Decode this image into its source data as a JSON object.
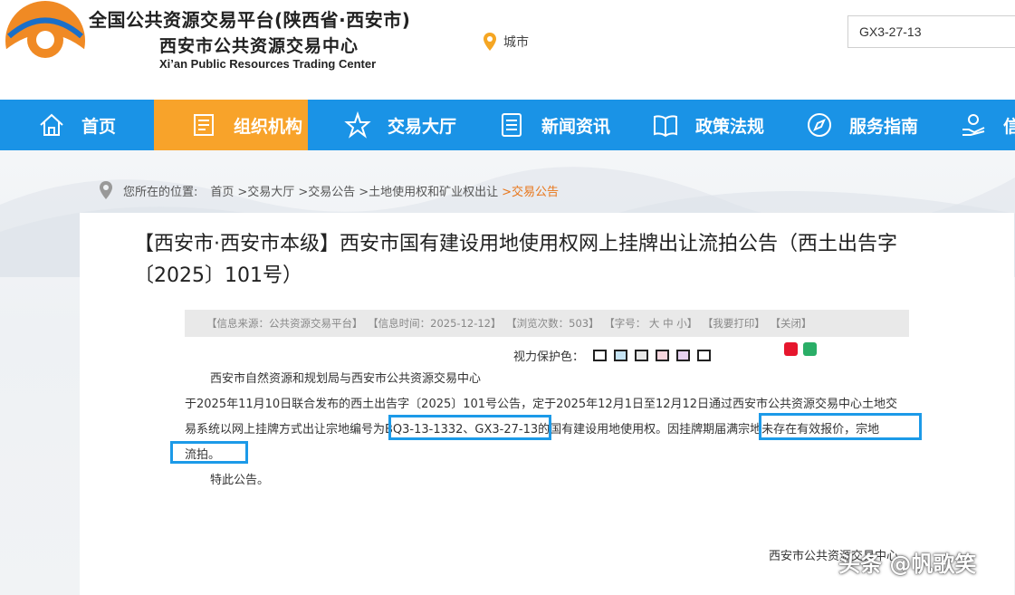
{
  "header": {
    "title_main": "全国公共资源交易平台(陕西省·西安市)",
    "title_sub": "西安市公共资源交易中心",
    "title_en": "Xi’an Public Resources Trading Center",
    "city_label": "城市",
    "search_value": "GX3-27-13"
  },
  "nav": {
    "items": [
      {
        "label": "首页",
        "icon": "home-icon"
      },
      {
        "label": "组织机构",
        "icon": "document-icon"
      },
      {
        "label": "交易大厅",
        "icon": "star-icon"
      },
      {
        "label": "新闻资讯",
        "icon": "list-icon"
      },
      {
        "label": "政策法规",
        "icon": "book-icon"
      },
      {
        "label": "服务指南",
        "icon": "compass-icon"
      },
      {
        "label": "信息",
        "icon": "hand-icon"
      }
    ],
    "active_index": 1
  },
  "breadcrumb": {
    "prefix": "您所在的位置:",
    "items": [
      "首页",
      ">交易大厅",
      ">交易公告",
      ">土地使用权和矿业权出让"
    ],
    "current": ">交易公告"
  },
  "article": {
    "title_line1": "【西安市·西安市本级】西安市国有建设用地使用权网上挂牌出让流拍公告（西土出告字",
    "title_line2": "〔2025〕101号）",
    "info": {
      "source": "【信息来源：公共资源交易平台】",
      "time": "【信息时间：2025-12-12】",
      "views": "【浏览次数：503】",
      "font_size": "【字号： 大 中 小】",
      "print": "【我要打印】",
      "close": "【关闭】"
    },
    "eye_care_label": "视力保护色：",
    "eye_care_colors": [
      "#ffffff",
      "#c5e3f3",
      "#e8e8e8",
      "#f6d6de",
      "#e7d2f0",
      "#ffffff"
    ],
    "paragraph": {
      "line1": "西安市自然资源和规划局与西安市公共资源交易中心",
      "line2": "于2025年11月10日联合发布的西土出告字〔2025〕101号公告，定于2025年12月1日至12月12日通过西安市公共资源交易中心土地交",
      "line3": "易系统以网上挂牌方式出让宗地编号为BQ3-13-1332、GX3-27-13的国有建设用地使用权。因挂牌期届满宗地未存在有效报价，宗地",
      "line4": "流拍。"
    },
    "closing": "特此公告。",
    "signature": "西安市公共资源交易中心"
  },
  "watermark": "头条 @帆歌笑",
  "colors": {
    "nav_bg": "#1a93e6",
    "nav_active": "#f8a32a",
    "highlight_box": "#1c9ae8",
    "logo_orange": "#f08a24"
  }
}
